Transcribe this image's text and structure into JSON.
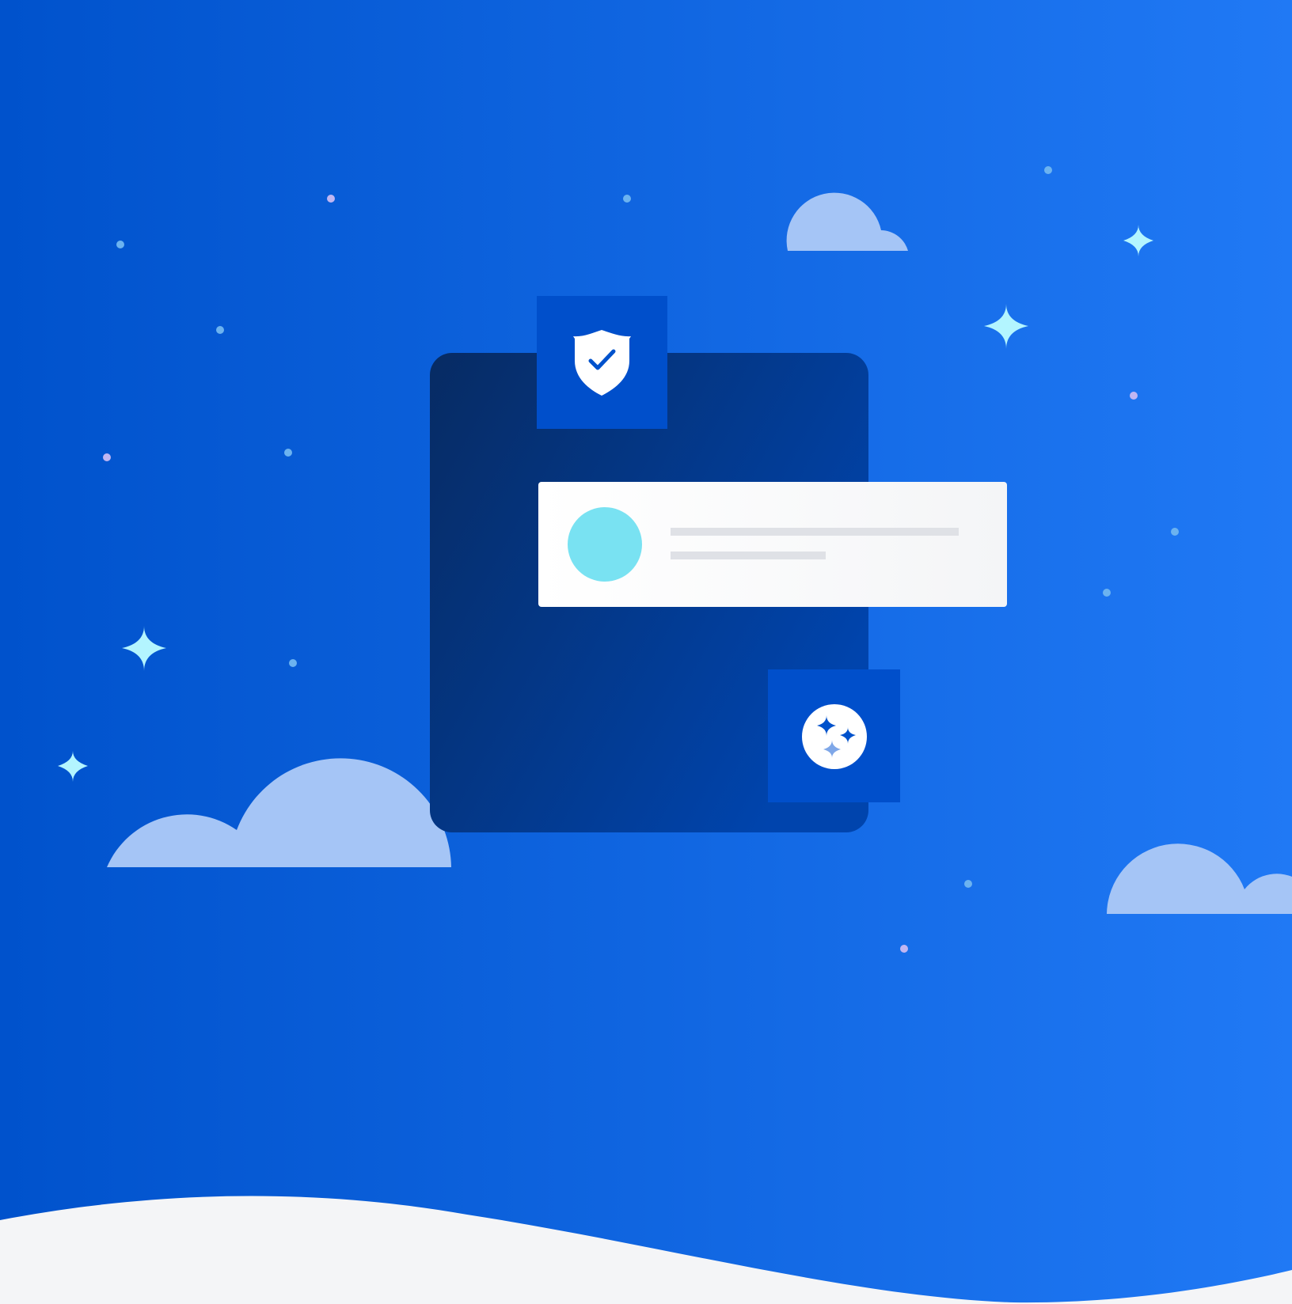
{
  "illustration": {
    "colors": {
      "background_start": "#0052CC",
      "background_end": "#2079F5",
      "ground": "#F4F5F7",
      "cloud": "#A5C5F6",
      "dark_panel_start": "#072B63",
      "dark_panel_end": "#0044AD",
      "icon_tile": "#004FCB",
      "sparkle": "#B3F5FF",
      "dot": "#6CB3F0",
      "dot_alt": "#C0B6F2",
      "avatar": "#79E2F2",
      "card": "#FFFFFF",
      "text_line": "#DFE1E6"
    },
    "icons": {
      "top_tile": "shield-check-icon",
      "bottom_tile": "sparkles-icon"
    }
  }
}
